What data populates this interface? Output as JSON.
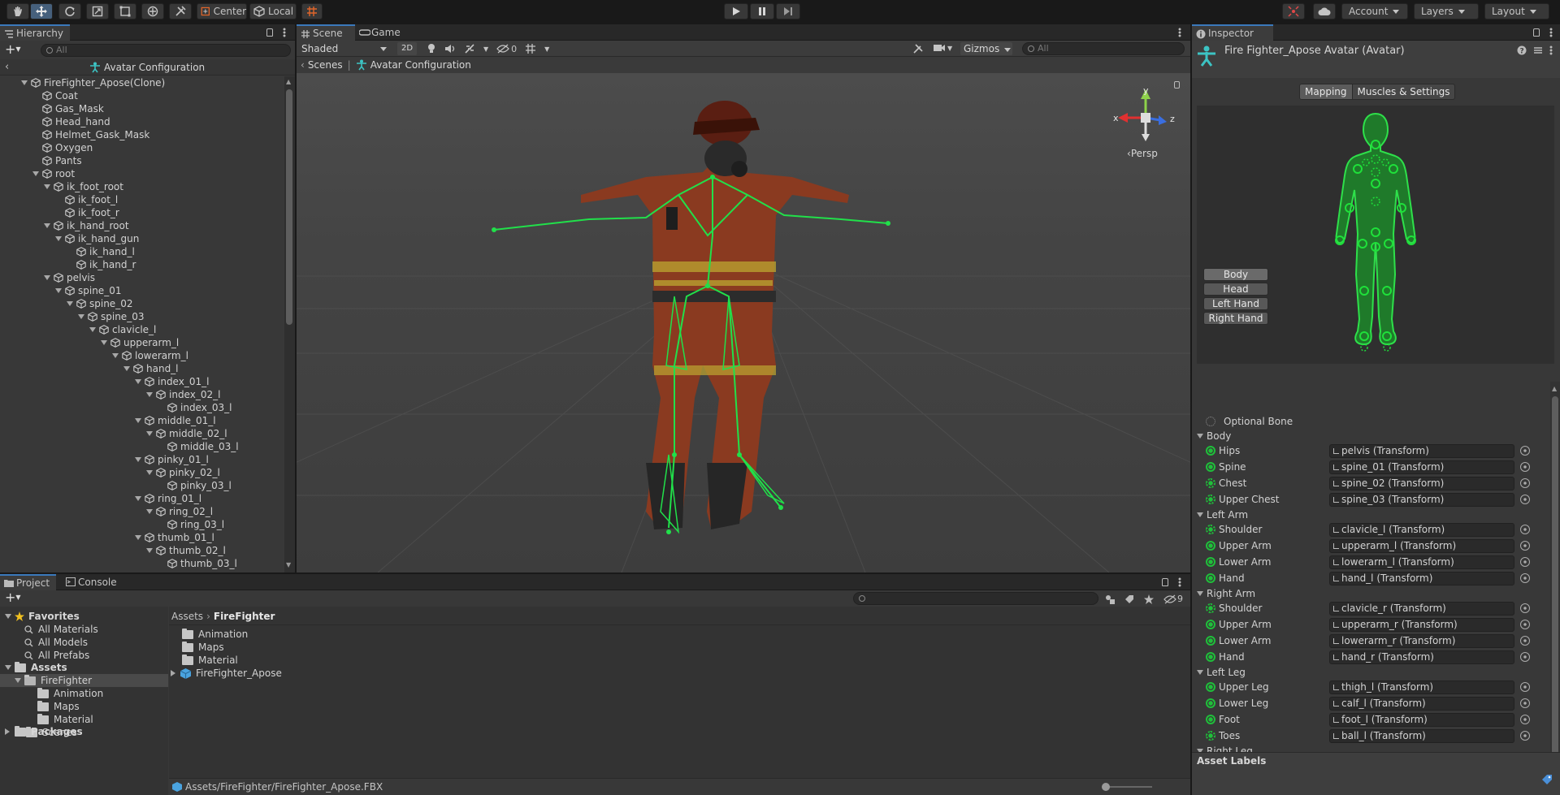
{
  "toolbar": {
    "pivot_mode": "Center",
    "pivot_rotation": "Local",
    "account_label": "Account",
    "layers_label": "Layers",
    "layout_label": "Layout",
    "tools": [
      "hand-tool-icon",
      "move-tool-icon",
      "rotate-tool-icon",
      "scale-tool-icon",
      "rect-tool-icon",
      "transform-tool-icon",
      "custom-tool-icon"
    ]
  },
  "hierarchy": {
    "tab_label": "Hierarchy",
    "search_placeholder": "All",
    "breadcrumb": "Avatar Configuration",
    "items": [
      {
        "label": "FireFighter_Apose(Clone)",
        "depth": 0,
        "expanded": true
      },
      {
        "label": "Coat",
        "depth": 1,
        "expanded": null
      },
      {
        "label": "Gas_Mask",
        "depth": 1,
        "expanded": null
      },
      {
        "label": "Head_hand",
        "depth": 1,
        "expanded": null
      },
      {
        "label": "Helmet_Gask_Mask",
        "depth": 1,
        "expanded": null
      },
      {
        "label": "Oxygen",
        "depth": 1,
        "expanded": null
      },
      {
        "label": "Pants",
        "depth": 1,
        "expanded": null
      },
      {
        "label": "root",
        "depth": 1,
        "expanded": true
      },
      {
        "label": "ik_foot_root",
        "depth": 2,
        "expanded": true
      },
      {
        "label": "ik_foot_l",
        "depth": 3,
        "expanded": null
      },
      {
        "label": "ik_foot_r",
        "depth": 3,
        "expanded": null
      },
      {
        "label": "ik_hand_root",
        "depth": 2,
        "expanded": true
      },
      {
        "label": "ik_hand_gun",
        "depth": 3,
        "expanded": true
      },
      {
        "label": "ik_hand_l",
        "depth": 4,
        "expanded": null
      },
      {
        "label": "ik_hand_r",
        "depth": 4,
        "expanded": null
      },
      {
        "label": "pelvis",
        "depth": 2,
        "expanded": true
      },
      {
        "label": "spine_01",
        "depth": 3,
        "expanded": true
      },
      {
        "label": "spine_02",
        "depth": 4,
        "expanded": true
      },
      {
        "label": "spine_03",
        "depth": 5,
        "expanded": true
      },
      {
        "label": "clavicle_l",
        "depth": 6,
        "expanded": true
      },
      {
        "label": "upperarm_l",
        "depth": 7,
        "expanded": true
      },
      {
        "label": "lowerarm_l",
        "depth": 8,
        "expanded": true
      },
      {
        "label": "hand_l",
        "depth": 9,
        "expanded": true
      },
      {
        "label": "index_01_l",
        "depth": 10,
        "expanded": true
      },
      {
        "label": "index_02_l",
        "depth": 11,
        "expanded": true
      },
      {
        "label": "index_03_l",
        "depth": 12,
        "expanded": null
      },
      {
        "label": "middle_01_l",
        "depth": 10,
        "expanded": true
      },
      {
        "label": "middle_02_l",
        "depth": 11,
        "expanded": true
      },
      {
        "label": "middle_03_l",
        "depth": 12,
        "expanded": null
      },
      {
        "label": "pinky_01_l",
        "depth": 10,
        "expanded": true
      },
      {
        "label": "pinky_02_l",
        "depth": 11,
        "expanded": true
      },
      {
        "label": "pinky_03_l",
        "depth": 12,
        "expanded": null
      },
      {
        "label": "ring_01_l",
        "depth": 10,
        "expanded": true
      },
      {
        "label": "ring_02_l",
        "depth": 11,
        "expanded": true
      },
      {
        "label": "ring_03_l",
        "depth": 12,
        "expanded": null
      },
      {
        "label": "thumb_01_l",
        "depth": 10,
        "expanded": true
      },
      {
        "label": "thumb_02_l",
        "depth": 11,
        "expanded": true
      },
      {
        "label": "thumb_03_l",
        "depth": 12,
        "expanded": null
      }
    ]
  },
  "scene": {
    "tabs": [
      "Scene",
      "Game"
    ],
    "draw_mode": "Shaded",
    "mode_2d": "2D",
    "hidden_count": "0",
    "gizmos_label": "Gizmos",
    "search_placeholder": "All",
    "breadcrumb_root": "Scenes",
    "breadcrumb_current": "Avatar Configuration",
    "projection": "Persp",
    "axis_x": "x",
    "axis_y": "y",
    "axis_z": "z"
  },
  "project": {
    "tabs": [
      "Project",
      "Console"
    ],
    "hidden_count": "9",
    "favorites_label": "Favorites",
    "favorites": [
      "All Materials",
      "All Models",
      "All Prefabs"
    ],
    "assets_label": "Assets",
    "tree": [
      {
        "label": "FireFighter",
        "depth": 1,
        "selected": true
      },
      {
        "label": "Animation",
        "depth": 2,
        "selected": false
      },
      {
        "label": "Maps",
        "depth": 2,
        "selected": false
      },
      {
        "label": "Material",
        "depth": 2,
        "selected": false
      },
      {
        "label": "Scenes",
        "depth": 1,
        "selected": false
      }
    ],
    "packages_label": "Packages",
    "breadcrumb_root": "Assets",
    "breadcrumb_current": "FireFighter",
    "files": [
      "Animation",
      "Maps",
      "Material",
      "FireFighter_Apose"
    ],
    "status_path": "Assets/FireFighter/FireFighter_Apose.FBX"
  },
  "inspector": {
    "tab_label": "Inspector",
    "title": "Fire Fighter_Apose Avatar (Avatar)",
    "sub_tabs": [
      "Mapping",
      "Muscles & Settings"
    ],
    "part_buttons": [
      "Body",
      "Head",
      "Left Hand",
      "Right Hand"
    ],
    "optional_bone_label": "Optional Bone",
    "sections": [
      {
        "name": "Body",
        "rows": [
          {
            "bone": "Hips",
            "value": "pelvis (Transform)",
            "optional": false
          },
          {
            "bone": "Spine",
            "value": "spine_01 (Transform)",
            "optional": false
          },
          {
            "bone": "Chest",
            "value": "spine_02 (Transform)",
            "optional": true
          },
          {
            "bone": "Upper Chest",
            "value": "spine_03 (Transform)",
            "optional": true
          }
        ]
      },
      {
        "name": "Left Arm",
        "rows": [
          {
            "bone": "Shoulder",
            "value": "clavicle_l (Transform)",
            "optional": true
          },
          {
            "bone": "Upper Arm",
            "value": "upperarm_l (Transform)",
            "optional": false
          },
          {
            "bone": "Lower Arm",
            "value": "lowerarm_l (Transform)",
            "optional": false
          },
          {
            "bone": "Hand",
            "value": "hand_l (Transform)",
            "optional": false
          }
        ]
      },
      {
        "name": "Right Arm",
        "rows": [
          {
            "bone": "Shoulder",
            "value": "clavicle_r (Transform)",
            "optional": true
          },
          {
            "bone": "Upper Arm",
            "value": "upperarm_r (Transform)",
            "optional": false
          },
          {
            "bone": "Lower Arm",
            "value": "lowerarm_r (Transform)",
            "optional": false
          },
          {
            "bone": "Hand",
            "value": "hand_r (Transform)",
            "optional": false
          }
        ]
      },
      {
        "name": "Left Leg",
        "rows": [
          {
            "bone": "Upper Leg",
            "value": "thigh_l (Transform)",
            "optional": false
          },
          {
            "bone": "Lower Leg",
            "value": "calf_l (Transform)",
            "optional": false
          },
          {
            "bone": "Foot",
            "value": "foot_l (Transform)",
            "optional": false
          },
          {
            "bone": "Toes",
            "value": "ball_l (Transform)",
            "optional": true
          }
        ]
      }
    ],
    "next_section_partial": "Right Leg",
    "asset_labels": "Asset Labels"
  },
  "colors": {
    "accent": "#3a79bb",
    "bone_green": "#1fbf3a",
    "panel_bg": "#383838",
    "scene_bg": "#474747"
  }
}
